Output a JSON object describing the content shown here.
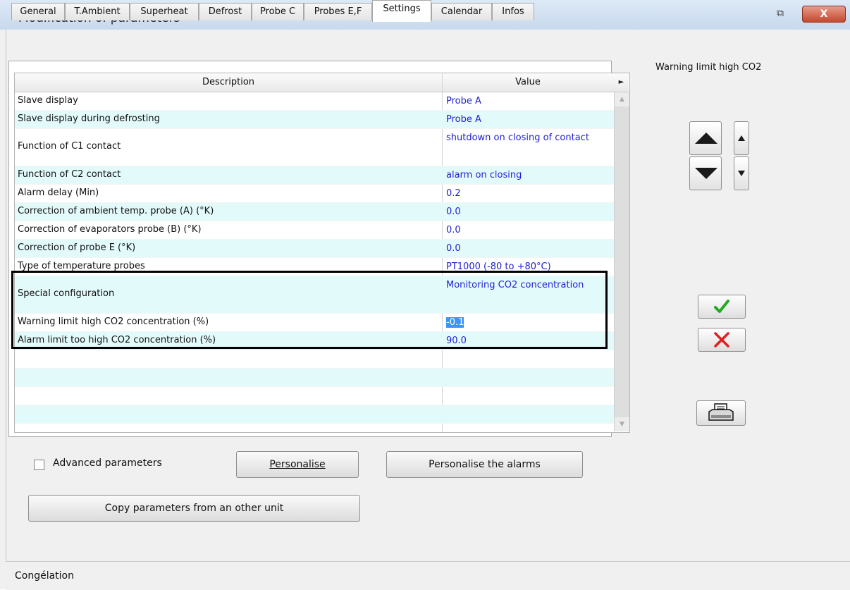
{
  "window": {
    "title": "Modification of parameters",
    "restore_icon": "restore-icon",
    "close_label": "X"
  },
  "tabs": [
    {
      "label": "General"
    },
    {
      "label": "T.Ambient"
    },
    {
      "label": "Superheat"
    },
    {
      "label": "Defrost"
    },
    {
      "label": "Probe C"
    },
    {
      "label": "Probes E,F"
    },
    {
      "label": "Settings",
      "active": true
    },
    {
      "label": "Calendar"
    },
    {
      "label": "Infos"
    }
  ],
  "table": {
    "col_description": "Description",
    "col_value": "Value",
    "rows": [
      {
        "description": "Slave display",
        "value": "Probe A"
      },
      {
        "description": "Slave display during defrosting",
        "value": "Probe A"
      },
      {
        "description": "Function of C1 contact",
        "value": "shutdown on closing of contact"
      },
      {
        "description": "Function of C2 contact",
        "value": "alarm on closing"
      },
      {
        "description": "Alarm delay (Min)",
        "value": "0.2"
      },
      {
        "description": "Correction of ambient temp. probe (A) (°K)",
        "value": "0.0"
      },
      {
        "description": "Correction of evaporators probe (B) (°K)",
        "value": "0.0"
      },
      {
        "description": "Correction of probe E (°K)",
        "value": "0.0"
      },
      {
        "description": "Type of temperature probes",
        "value": "PT1000 (-80 to +80°C)"
      },
      {
        "description": "Special configuration",
        "value": "Monitoring CO2 concentration"
      },
      {
        "description": "Warning limit high CO2 concentration (%)",
        "value": "-0.1"
      },
      {
        "description": "Alarm limit too high CO2 concentration (%)",
        "value": "90.0"
      }
    ]
  },
  "side": {
    "selected_param_label": "Warning limit high CO2"
  },
  "bottom": {
    "advanced_label": "Advanced parameters",
    "personalise_label": "Personalise",
    "personalise_alarms_label": "Personalise the alarms",
    "copy_label": "Copy parameters from an other unit"
  },
  "status": {
    "text": "Congélation"
  },
  "colors": {
    "value_text": "#1f1fd6",
    "row_alt": "#e3fafb",
    "selection": "#3399ff",
    "ok_check": "#22aa22",
    "cancel_x": "#e02020"
  }
}
